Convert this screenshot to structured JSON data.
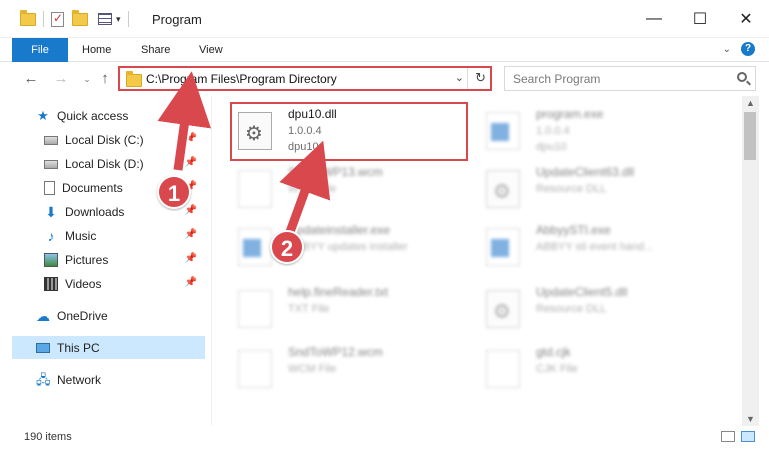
{
  "window": {
    "title": "Program",
    "minimize": "—",
    "maximize": "☐",
    "close": "✕"
  },
  "ribbon": {
    "tabs": [
      "File",
      "Home",
      "Share",
      "View"
    ],
    "help": "?"
  },
  "address": {
    "path": "C:\\Program Files\\Program Directory",
    "search_placeholder": "Search Program"
  },
  "sidebar": {
    "quick_access": "Quick access",
    "items": [
      {
        "label": "Local Disk (C:)"
      },
      {
        "label": "Local Disk (D:)"
      },
      {
        "label": "Documents"
      },
      {
        "label": "Downloads"
      },
      {
        "label": "Music"
      },
      {
        "label": "Pictures"
      },
      {
        "label": "Videos"
      }
    ],
    "onedrive": "OneDrive",
    "this_pc": "This PC",
    "network": "Network"
  },
  "files": [
    {
      "name": "dpu10.dll",
      "line2": "1.0.0.4",
      "line3": "dpu10",
      "icon": "dll-icon"
    },
    {
      "name": "program.exe",
      "line2": "1.0.0.4",
      "line3": "dpu10",
      "icon": "exe-icon"
    },
    {
      "name": "SndToWP13.wcm",
      "line2": "WCM File",
      "icon": "file-icon"
    },
    {
      "name": "UpdateClient63.dll",
      "line2": "Resource DLL",
      "icon": "dll-icon"
    },
    {
      "name": "Updateinstaller.exe",
      "line2": "ABBYY updates installer",
      "icon": "exe-icon"
    },
    {
      "name": "AbbyySTI.exe",
      "line2": "ABBYY sti event hand...",
      "icon": "exe-icon"
    },
    {
      "name": "help.fineReader.txt",
      "line2": "TXT File",
      "icon": "file-icon"
    },
    {
      "name": "UpdateClient5.dll",
      "line2": "Resource DLL",
      "icon": "dll-icon"
    },
    {
      "name": "SndToWP12.wcm",
      "line2": "WCM File",
      "icon": "file-icon"
    },
    {
      "name": "gtd.cjk",
      "line2": "CJK File",
      "icon": "file-icon"
    }
  ],
  "status": {
    "items": "190 items"
  },
  "annotations": {
    "step1": "1",
    "step2": "2",
    "color": "#d9484d"
  }
}
